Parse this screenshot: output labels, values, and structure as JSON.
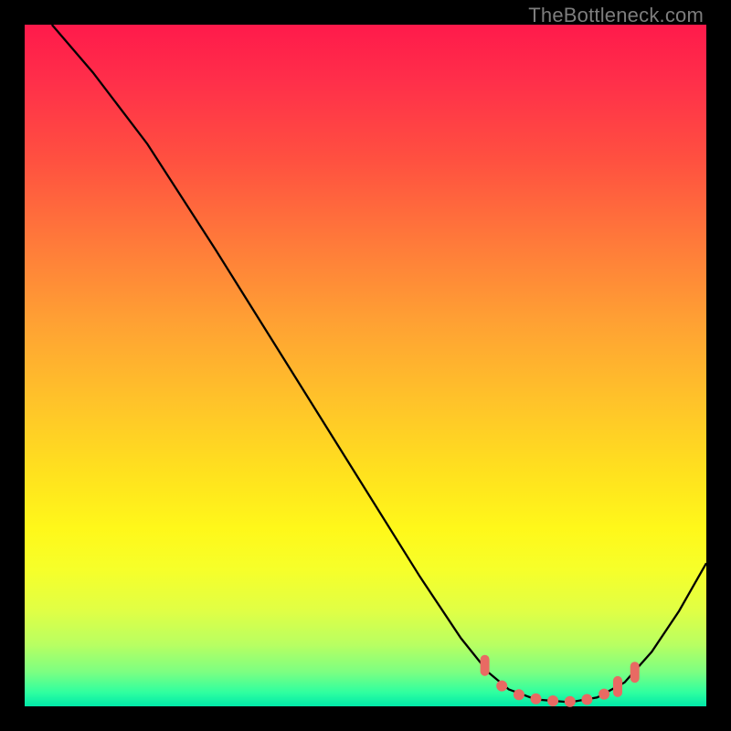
{
  "watermark": "TheBottleneck.com",
  "chart_data": {
    "type": "line",
    "title": "",
    "xlabel": "",
    "ylabel": "",
    "xlim": [
      0,
      100
    ],
    "ylim": [
      0,
      100
    ],
    "curve": [
      {
        "x": 4.0,
        "y": 100.0
      },
      {
        "x": 10.0,
        "y": 93.0
      },
      {
        "x": 18.0,
        "y": 82.5
      },
      {
        "x": 28.0,
        "y": 67.0
      },
      {
        "x": 38.0,
        "y": 51.0
      },
      {
        "x": 48.0,
        "y": 35.0
      },
      {
        "x": 58.0,
        "y": 19.0
      },
      {
        "x": 64.0,
        "y": 10.0
      },
      {
        "x": 68.0,
        "y": 5.0
      },
      {
        "x": 71.0,
        "y": 2.5
      },
      {
        "x": 75.0,
        "y": 1.0
      },
      {
        "x": 80.0,
        "y": 0.6
      },
      {
        "x": 84.0,
        "y": 1.3
      },
      {
        "x": 88.0,
        "y": 3.5
      },
      {
        "x": 92.0,
        "y": 8.0
      },
      {
        "x": 96.0,
        "y": 14.0
      },
      {
        "x": 100.0,
        "y": 21.0
      }
    ],
    "markers": [
      {
        "x": 67.5,
        "y": 6.0,
        "shape": "vertical"
      },
      {
        "x": 70.0,
        "y": 3.0,
        "shape": "round"
      },
      {
        "x": 72.5,
        "y": 1.7,
        "shape": "round"
      },
      {
        "x": 75.0,
        "y": 1.1,
        "shape": "round"
      },
      {
        "x": 77.5,
        "y": 0.8,
        "shape": "round"
      },
      {
        "x": 80.0,
        "y": 0.7,
        "shape": "round"
      },
      {
        "x": 82.5,
        "y": 1.0,
        "shape": "round"
      },
      {
        "x": 85.0,
        "y": 1.8,
        "shape": "round"
      },
      {
        "x": 87.0,
        "y": 2.9,
        "shape": "vertical"
      },
      {
        "x": 89.5,
        "y": 5.0,
        "shape": "vertical"
      }
    ],
    "gradient_stops": [
      {
        "pos": 0.0,
        "color": "#ff1a4b"
      },
      {
        "pos": 0.5,
        "color": "#ffc529"
      },
      {
        "pos": 0.8,
        "color": "#f6ff2a"
      },
      {
        "pos": 1.0,
        "color": "#00e8a8"
      }
    ]
  }
}
